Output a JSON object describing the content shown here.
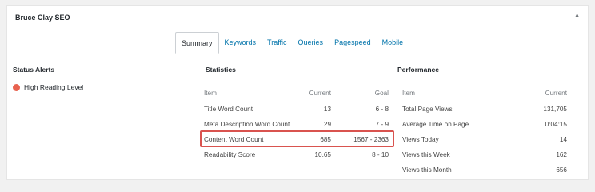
{
  "panel": {
    "title": "Bruce Clay SEO",
    "toggle_icon": "triangle-up-icon"
  },
  "tabs": [
    {
      "label": "Summary",
      "active": true
    },
    {
      "label": "Keywords",
      "active": false
    },
    {
      "label": "Traffic",
      "active": false
    },
    {
      "label": "Queries",
      "active": false
    },
    {
      "label": "Pagespeed",
      "active": false
    },
    {
      "label": "Mobile",
      "active": false
    }
  ],
  "status_alerts": {
    "title": "Status Alerts",
    "items": [
      {
        "label": "High Reading Level",
        "color": "#e8624f"
      }
    ]
  },
  "statistics": {
    "title": "Statistics",
    "headers": {
      "item": "Item",
      "current": "Current",
      "goal": "Goal"
    },
    "rows": [
      {
        "item": "Title Word Count",
        "current": "13",
        "goal": "6 - 8"
      },
      {
        "item": "Meta Description Word Count",
        "current": "29",
        "goal": "7 - 9"
      },
      {
        "item": "Content Word Count",
        "current": "685",
        "goal": "1567 - 2363"
      },
      {
        "item": "Readability Score",
        "current": "10.65",
        "goal": "8 - 10"
      }
    ],
    "highlight_color": "#d9534f"
  },
  "performance": {
    "title": "Performance",
    "headers": {
      "item": "Item",
      "current": "Current"
    },
    "rows": [
      {
        "item": "Total Page Views",
        "current": "131,705"
      },
      {
        "item": "Average Time on Page",
        "current": "0:04:15"
      },
      {
        "item": "Views Today",
        "current": "14"
      },
      {
        "item": "Views this Week",
        "current": "162"
      },
      {
        "item": "Views this Month",
        "current": "656"
      }
    ]
  }
}
